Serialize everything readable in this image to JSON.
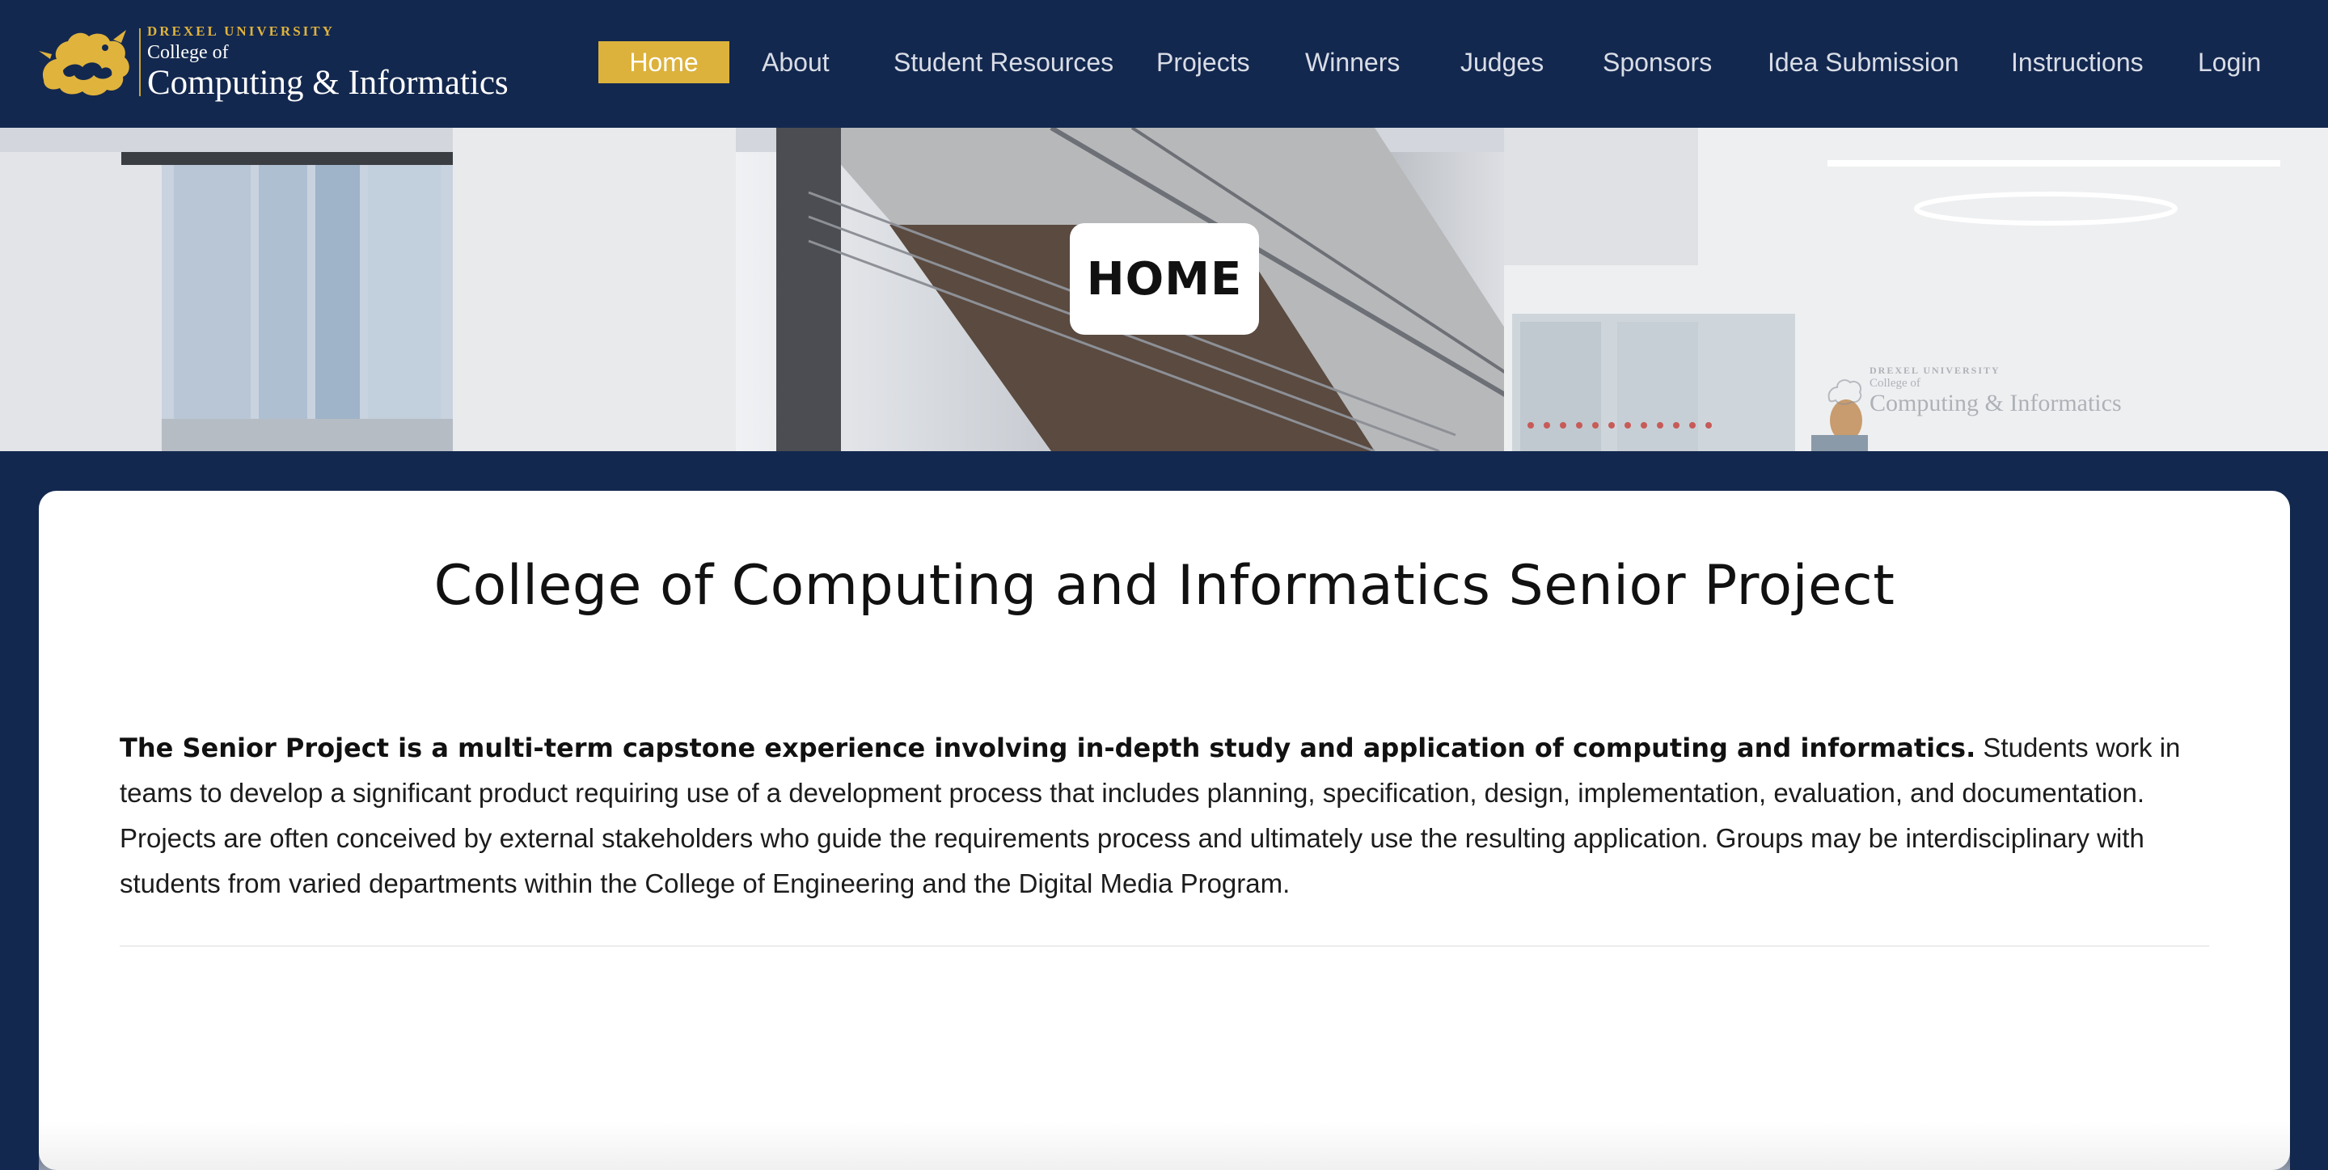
{
  "header": {
    "logo": {
      "university": "DREXEL UNIVERSITY",
      "college_of": "College of",
      "name": "Computing & Informatics"
    },
    "nav": [
      {
        "label": "Home",
        "active": true
      },
      {
        "label": "About"
      },
      {
        "label": "Student Resources"
      },
      {
        "label": "Projects"
      },
      {
        "label": "Winners"
      },
      {
        "label": "Judges"
      },
      {
        "label": "Sponsors"
      },
      {
        "label": "Idea Submission"
      },
      {
        "label": "Instructions"
      },
      {
        "label": "Login"
      }
    ]
  },
  "hero": {
    "title": "HOME",
    "watermark": {
      "university": "DREXEL UNIVERSITY",
      "college_of": "College of",
      "name": "Computing & Informatics"
    }
  },
  "main": {
    "title": "College of Computing and Informatics Senior Project",
    "intro_bold": "The Senior Project is a multi-term capstone experience involving in-depth study and application of computing and informatics.",
    "intro_text": " Students work in teams to develop a significant product requiring use of a development process that includes planning, specification, design, implementation, evaluation, and documentation. Projects are often conceived by external stakeholders who guide the requirements process and ultimately use the resulting application. Groups may be interdisciplinary with students from varied departments within the College of Engineering and the Digital Media Program."
  },
  "colors": {
    "navy": "#13284f",
    "gold": "#dcb23c",
    "white": "#ffffff"
  }
}
